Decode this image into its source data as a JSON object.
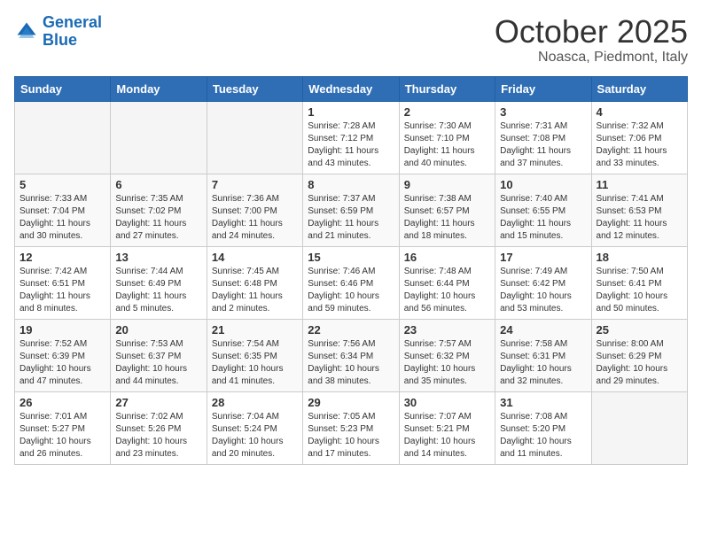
{
  "header": {
    "logo_line1": "General",
    "logo_line2": "Blue",
    "month": "October 2025",
    "location": "Noasca, Piedmont, Italy"
  },
  "weekdays": [
    "Sunday",
    "Monday",
    "Tuesday",
    "Wednesday",
    "Thursday",
    "Friday",
    "Saturday"
  ],
  "weeks": [
    [
      {
        "day": "",
        "info": ""
      },
      {
        "day": "",
        "info": ""
      },
      {
        "day": "",
        "info": ""
      },
      {
        "day": "1",
        "info": "Sunrise: 7:28 AM\nSunset: 7:12 PM\nDaylight: 11 hours and 43 minutes."
      },
      {
        "day": "2",
        "info": "Sunrise: 7:30 AM\nSunset: 7:10 PM\nDaylight: 11 hours and 40 minutes."
      },
      {
        "day": "3",
        "info": "Sunrise: 7:31 AM\nSunset: 7:08 PM\nDaylight: 11 hours and 37 minutes."
      },
      {
        "day": "4",
        "info": "Sunrise: 7:32 AM\nSunset: 7:06 PM\nDaylight: 11 hours and 33 minutes."
      }
    ],
    [
      {
        "day": "5",
        "info": "Sunrise: 7:33 AM\nSunset: 7:04 PM\nDaylight: 11 hours and 30 minutes."
      },
      {
        "day": "6",
        "info": "Sunrise: 7:35 AM\nSunset: 7:02 PM\nDaylight: 11 hours and 27 minutes."
      },
      {
        "day": "7",
        "info": "Sunrise: 7:36 AM\nSunset: 7:00 PM\nDaylight: 11 hours and 24 minutes."
      },
      {
        "day": "8",
        "info": "Sunrise: 7:37 AM\nSunset: 6:59 PM\nDaylight: 11 hours and 21 minutes."
      },
      {
        "day": "9",
        "info": "Sunrise: 7:38 AM\nSunset: 6:57 PM\nDaylight: 11 hours and 18 minutes."
      },
      {
        "day": "10",
        "info": "Sunrise: 7:40 AM\nSunset: 6:55 PM\nDaylight: 11 hours and 15 minutes."
      },
      {
        "day": "11",
        "info": "Sunrise: 7:41 AM\nSunset: 6:53 PM\nDaylight: 11 hours and 12 minutes."
      }
    ],
    [
      {
        "day": "12",
        "info": "Sunrise: 7:42 AM\nSunset: 6:51 PM\nDaylight: 11 hours and 8 minutes."
      },
      {
        "day": "13",
        "info": "Sunrise: 7:44 AM\nSunset: 6:49 PM\nDaylight: 11 hours and 5 minutes."
      },
      {
        "day": "14",
        "info": "Sunrise: 7:45 AM\nSunset: 6:48 PM\nDaylight: 11 hours and 2 minutes."
      },
      {
        "day": "15",
        "info": "Sunrise: 7:46 AM\nSunset: 6:46 PM\nDaylight: 10 hours and 59 minutes."
      },
      {
        "day": "16",
        "info": "Sunrise: 7:48 AM\nSunset: 6:44 PM\nDaylight: 10 hours and 56 minutes."
      },
      {
        "day": "17",
        "info": "Sunrise: 7:49 AM\nSunset: 6:42 PM\nDaylight: 10 hours and 53 minutes."
      },
      {
        "day": "18",
        "info": "Sunrise: 7:50 AM\nSunset: 6:41 PM\nDaylight: 10 hours and 50 minutes."
      }
    ],
    [
      {
        "day": "19",
        "info": "Sunrise: 7:52 AM\nSunset: 6:39 PM\nDaylight: 10 hours and 47 minutes."
      },
      {
        "day": "20",
        "info": "Sunrise: 7:53 AM\nSunset: 6:37 PM\nDaylight: 10 hours and 44 minutes."
      },
      {
        "day": "21",
        "info": "Sunrise: 7:54 AM\nSunset: 6:35 PM\nDaylight: 10 hours and 41 minutes."
      },
      {
        "day": "22",
        "info": "Sunrise: 7:56 AM\nSunset: 6:34 PM\nDaylight: 10 hours and 38 minutes."
      },
      {
        "day": "23",
        "info": "Sunrise: 7:57 AM\nSunset: 6:32 PM\nDaylight: 10 hours and 35 minutes."
      },
      {
        "day": "24",
        "info": "Sunrise: 7:58 AM\nSunset: 6:31 PM\nDaylight: 10 hours and 32 minutes."
      },
      {
        "day": "25",
        "info": "Sunrise: 8:00 AM\nSunset: 6:29 PM\nDaylight: 10 hours and 29 minutes."
      }
    ],
    [
      {
        "day": "26",
        "info": "Sunrise: 7:01 AM\nSunset: 5:27 PM\nDaylight: 10 hours and 26 minutes."
      },
      {
        "day": "27",
        "info": "Sunrise: 7:02 AM\nSunset: 5:26 PM\nDaylight: 10 hours and 23 minutes."
      },
      {
        "day": "28",
        "info": "Sunrise: 7:04 AM\nSunset: 5:24 PM\nDaylight: 10 hours and 20 minutes."
      },
      {
        "day": "29",
        "info": "Sunrise: 7:05 AM\nSunset: 5:23 PM\nDaylight: 10 hours and 17 minutes."
      },
      {
        "day": "30",
        "info": "Sunrise: 7:07 AM\nSunset: 5:21 PM\nDaylight: 10 hours and 14 minutes."
      },
      {
        "day": "31",
        "info": "Sunrise: 7:08 AM\nSunset: 5:20 PM\nDaylight: 10 hours and 11 minutes."
      },
      {
        "day": "",
        "info": ""
      }
    ]
  ]
}
